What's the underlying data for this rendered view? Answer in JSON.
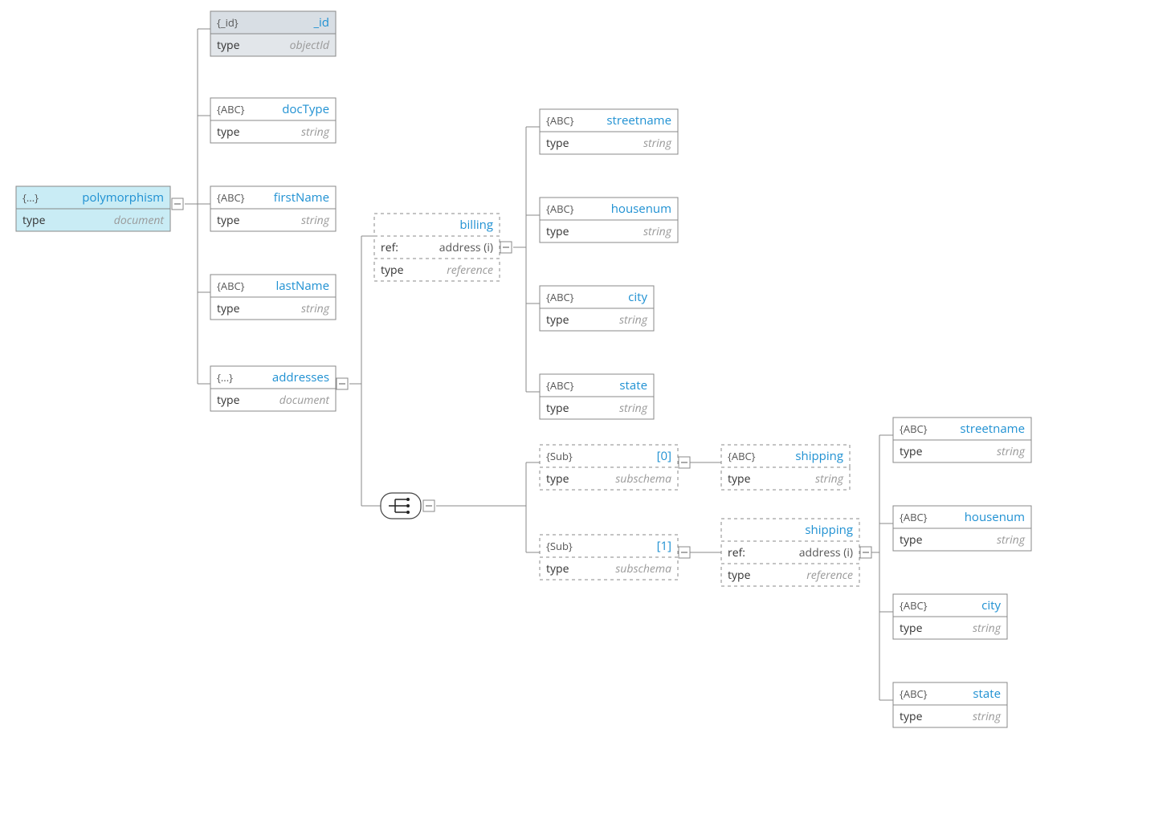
{
  "root": {
    "tag": "{...}",
    "name": "polymorphism",
    "row1k": "type",
    "row1v": "document"
  },
  "id": {
    "tag": "{_id}",
    "name": "_id",
    "row1k": "type",
    "row1v": "objectId"
  },
  "docType": {
    "tag": "{ABC}",
    "name": "docType",
    "row1k": "type",
    "row1v": "string"
  },
  "firstName": {
    "tag": "{ABC}",
    "name": "firstName",
    "row1k": "type",
    "row1v": "string"
  },
  "lastName": {
    "tag": "{ABC}",
    "name": "lastName",
    "row1k": "type",
    "row1v": "string"
  },
  "addresses": {
    "tag": "{...}",
    "name": "addresses",
    "row1k": "type",
    "row1v": "document"
  },
  "billing": {
    "tag": "",
    "name": "billing",
    "row1k": "ref:",
    "row1v": "address (i)",
    "row2k": "type",
    "row2v": "reference"
  },
  "street1": {
    "tag": "{ABC}",
    "name": "streetname",
    "row1k": "type",
    "row1v": "string"
  },
  "house1": {
    "tag": "{ABC}",
    "name": "housenum",
    "row1k": "type",
    "row1v": "string"
  },
  "city1": {
    "tag": "{ABC}",
    "name": "city",
    "row1k": "type",
    "row1v": "string"
  },
  "state1": {
    "tag": "{ABC}",
    "name": "state",
    "row1k": "type",
    "row1v": "string"
  },
  "sub0": {
    "tag": "{Sub}",
    "name": "[0]",
    "row1k": "type",
    "row1v": "subschema"
  },
  "sub1": {
    "tag": "{Sub}",
    "name": "[1]",
    "row1k": "type",
    "row1v": "subschema"
  },
  "shipStr": {
    "tag": "{ABC}",
    "name": "shipping",
    "row1k": "type",
    "row1v": "string"
  },
  "shipRef": {
    "tag": "",
    "name": "shipping",
    "row1k": "ref:",
    "row1v": "address (i)",
    "row2k": "type",
    "row2v": "reference"
  },
  "street2": {
    "tag": "{ABC}",
    "name": "streetname",
    "row1k": "type",
    "row1v": "string"
  },
  "house2": {
    "tag": "{ABC}",
    "name": "housenum",
    "row1k": "type",
    "row1v": "string"
  },
  "city2": {
    "tag": "{ABC}",
    "name": "city",
    "row1k": "type",
    "row1v": "string"
  },
  "state2": {
    "tag": "{ABC}",
    "name": "state",
    "row1k": "type",
    "row1v": "string"
  }
}
